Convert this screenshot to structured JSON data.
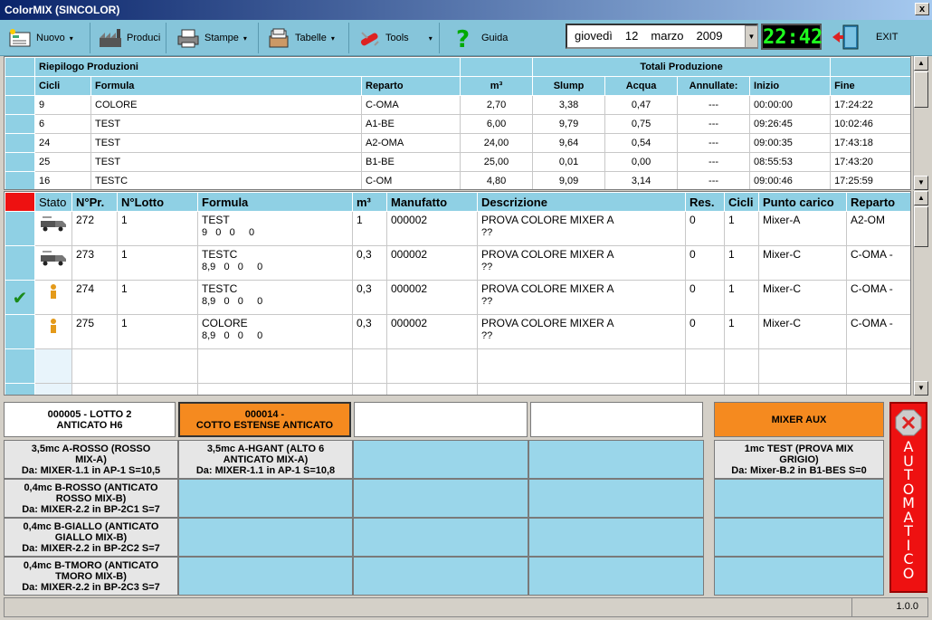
{
  "window": {
    "title": "ColorMIX (SINCOLOR)",
    "close": "x"
  },
  "toolbar": {
    "nuovo": "Nuovo",
    "produci": "Produci",
    "stampe": "Stampe",
    "tabelle": "Tabelle",
    "tools": "Tools",
    "guida": "Guida",
    "exit": "EXIT",
    "dropdown": "▾"
  },
  "date": {
    "weekday": "giovedì",
    "day": "12",
    "month": "marzo",
    "year": "2009",
    "arrow": "▼"
  },
  "clock": "22:42",
  "summary": {
    "header1": {
      "title": "Riepilogo Produzioni",
      "totals": "Totali  Produzione"
    },
    "columns": [
      "Cicli",
      "Formula",
      "Reparto",
      "m³",
      "Slump",
      "Acqua",
      "Annullate:",
      "Inizio",
      "Fine"
    ],
    "rows": [
      [
        "9",
        "COLORE",
        "C-OMA",
        "2,70",
        "3,38",
        "0,47",
        "---",
        "00:00:00",
        "17:24:22"
      ],
      [
        "6",
        "TEST",
        "A1-BE",
        "6,00",
        "9,79",
        "0,75",
        "---",
        "09:26:45",
        "10:02:46"
      ],
      [
        "24",
        "TEST",
        "A2-OMA",
        "24,00",
        "9,64",
        "0,54",
        "---",
        "09:00:35",
        "17:43:18"
      ],
      [
        "25",
        "TEST",
        "B1-BE",
        "25,00",
        "0,01",
        "0,00",
        "---",
        "08:55:53",
        "17:43:20"
      ],
      [
        "16",
        "TESTC",
        "C-OM",
        "4,80",
        "9,09",
        "3,14",
        "---",
        "09:00:46",
        "17:25:59"
      ]
    ]
  },
  "orders": {
    "columns": [
      "Stato",
      "N°Pr.",
      "N°Lotto",
      "Formula",
      "m³",
      "Manufatto",
      "Descrizione",
      "Res.",
      "Cicli",
      "Punto carico",
      "Reparto"
    ],
    "rows": [
      {
        "check": "",
        "stato": "truck-icon",
        "npr": "272",
        "lotto": "1",
        "formula": "TEST",
        "formula2": "9   0   0     0",
        "m3": "1",
        "manufatto": "000002",
        "descr": "PROVA COLORE MIXER A",
        "descr2": "??",
        "res": "0",
        "cicli": "1",
        "punto": "Mixer-A",
        "reparto": "A2-OM",
        "mark": ""
      },
      {
        "check": "",
        "stato": "truck-icon",
        "npr": "273",
        "lotto": "1",
        "formula": "TESTC",
        "formula2": "8,9   0   0     0",
        "m3": "0,3",
        "manufatto": "000002",
        "descr": "PROVA COLORE MIXER A",
        "descr2": "??",
        "res": "0",
        "cicli": "1",
        "punto": "Mixer-C",
        "reparto": "C-OMA",
        "mark": "-"
      },
      {
        "check": "✔",
        "stato": "person-icon",
        "npr": "274",
        "lotto": "1",
        "formula": "TESTC",
        "formula2": "8,9   0   0     0",
        "m3": "0,3",
        "manufatto": "000002",
        "descr": "PROVA COLORE MIXER A",
        "descr2": "??",
        "res": "0",
        "cicli": "1",
        "punto": "Mixer-C",
        "reparto": "C-OMA",
        "mark": "-"
      },
      {
        "check": "",
        "stato": "person-icon",
        "npr": "275",
        "lotto": "1",
        "formula": "COLORE",
        "formula2": "8,9   0   0     0",
        "m3": "0,3",
        "manufatto": "000002",
        "descr": "PROVA COLORE MIXER A",
        "descr2": "??",
        "res": "0",
        "cicli": "1",
        "punto": "Mixer-C",
        "reparto": "C-OMA",
        "mark": "-"
      }
    ]
  },
  "panels": {
    "top": {
      "p1a": "000005 - LOTTO 2",
      "p1b": "ANTICATO H6",
      "p2a": "000014 -",
      "p2b": "COTTO ESTENSE ANTICATO",
      "mixer_aux": "MIXER AUX"
    },
    "col1": [
      {
        "l1": "3,5mc A-ROSSO (ROSSO",
        "l2": "MIX-A)",
        "l3": "Da: MIXER-1.1 in AP-1 S=10,5"
      },
      {
        "l1": "0,4mc B-ROSSO (ANTICATO",
        "l2": "ROSSO MIX-B)",
        "l3": "Da: MIXER-2.2 in BP-2C1 S=7"
      },
      {
        "l1": "0,4mc B-GIALLO (ANTICATO",
        "l2": "GIALLO MIX-B)",
        "l3": "Da: MIXER-2.2 in BP-2C2 S=7"
      },
      {
        "l1": "0,4mc B-TMORO (ANTICATO",
        "l2": "TMORO MIX-B)",
        "l3": "Da: MIXER-2.2 in BP-2C3 S=7"
      }
    ],
    "col2": {
      "l1": "3,5mc A-HGANT (ALTO 6",
      "l2": "ANTICATO MIX-A)",
      "l3": "Da: MIXER-1.1 in AP-1 S=10,8"
    },
    "aux": {
      "l1": "1mc TEST (PROVA MIX",
      "l2": "GRIGIO)",
      "l3": "Da: Mixer-B.2 in B1-BES S=0"
    },
    "automatico": "AUTOMATICO"
  },
  "status": {
    "version": "1.0.0"
  }
}
